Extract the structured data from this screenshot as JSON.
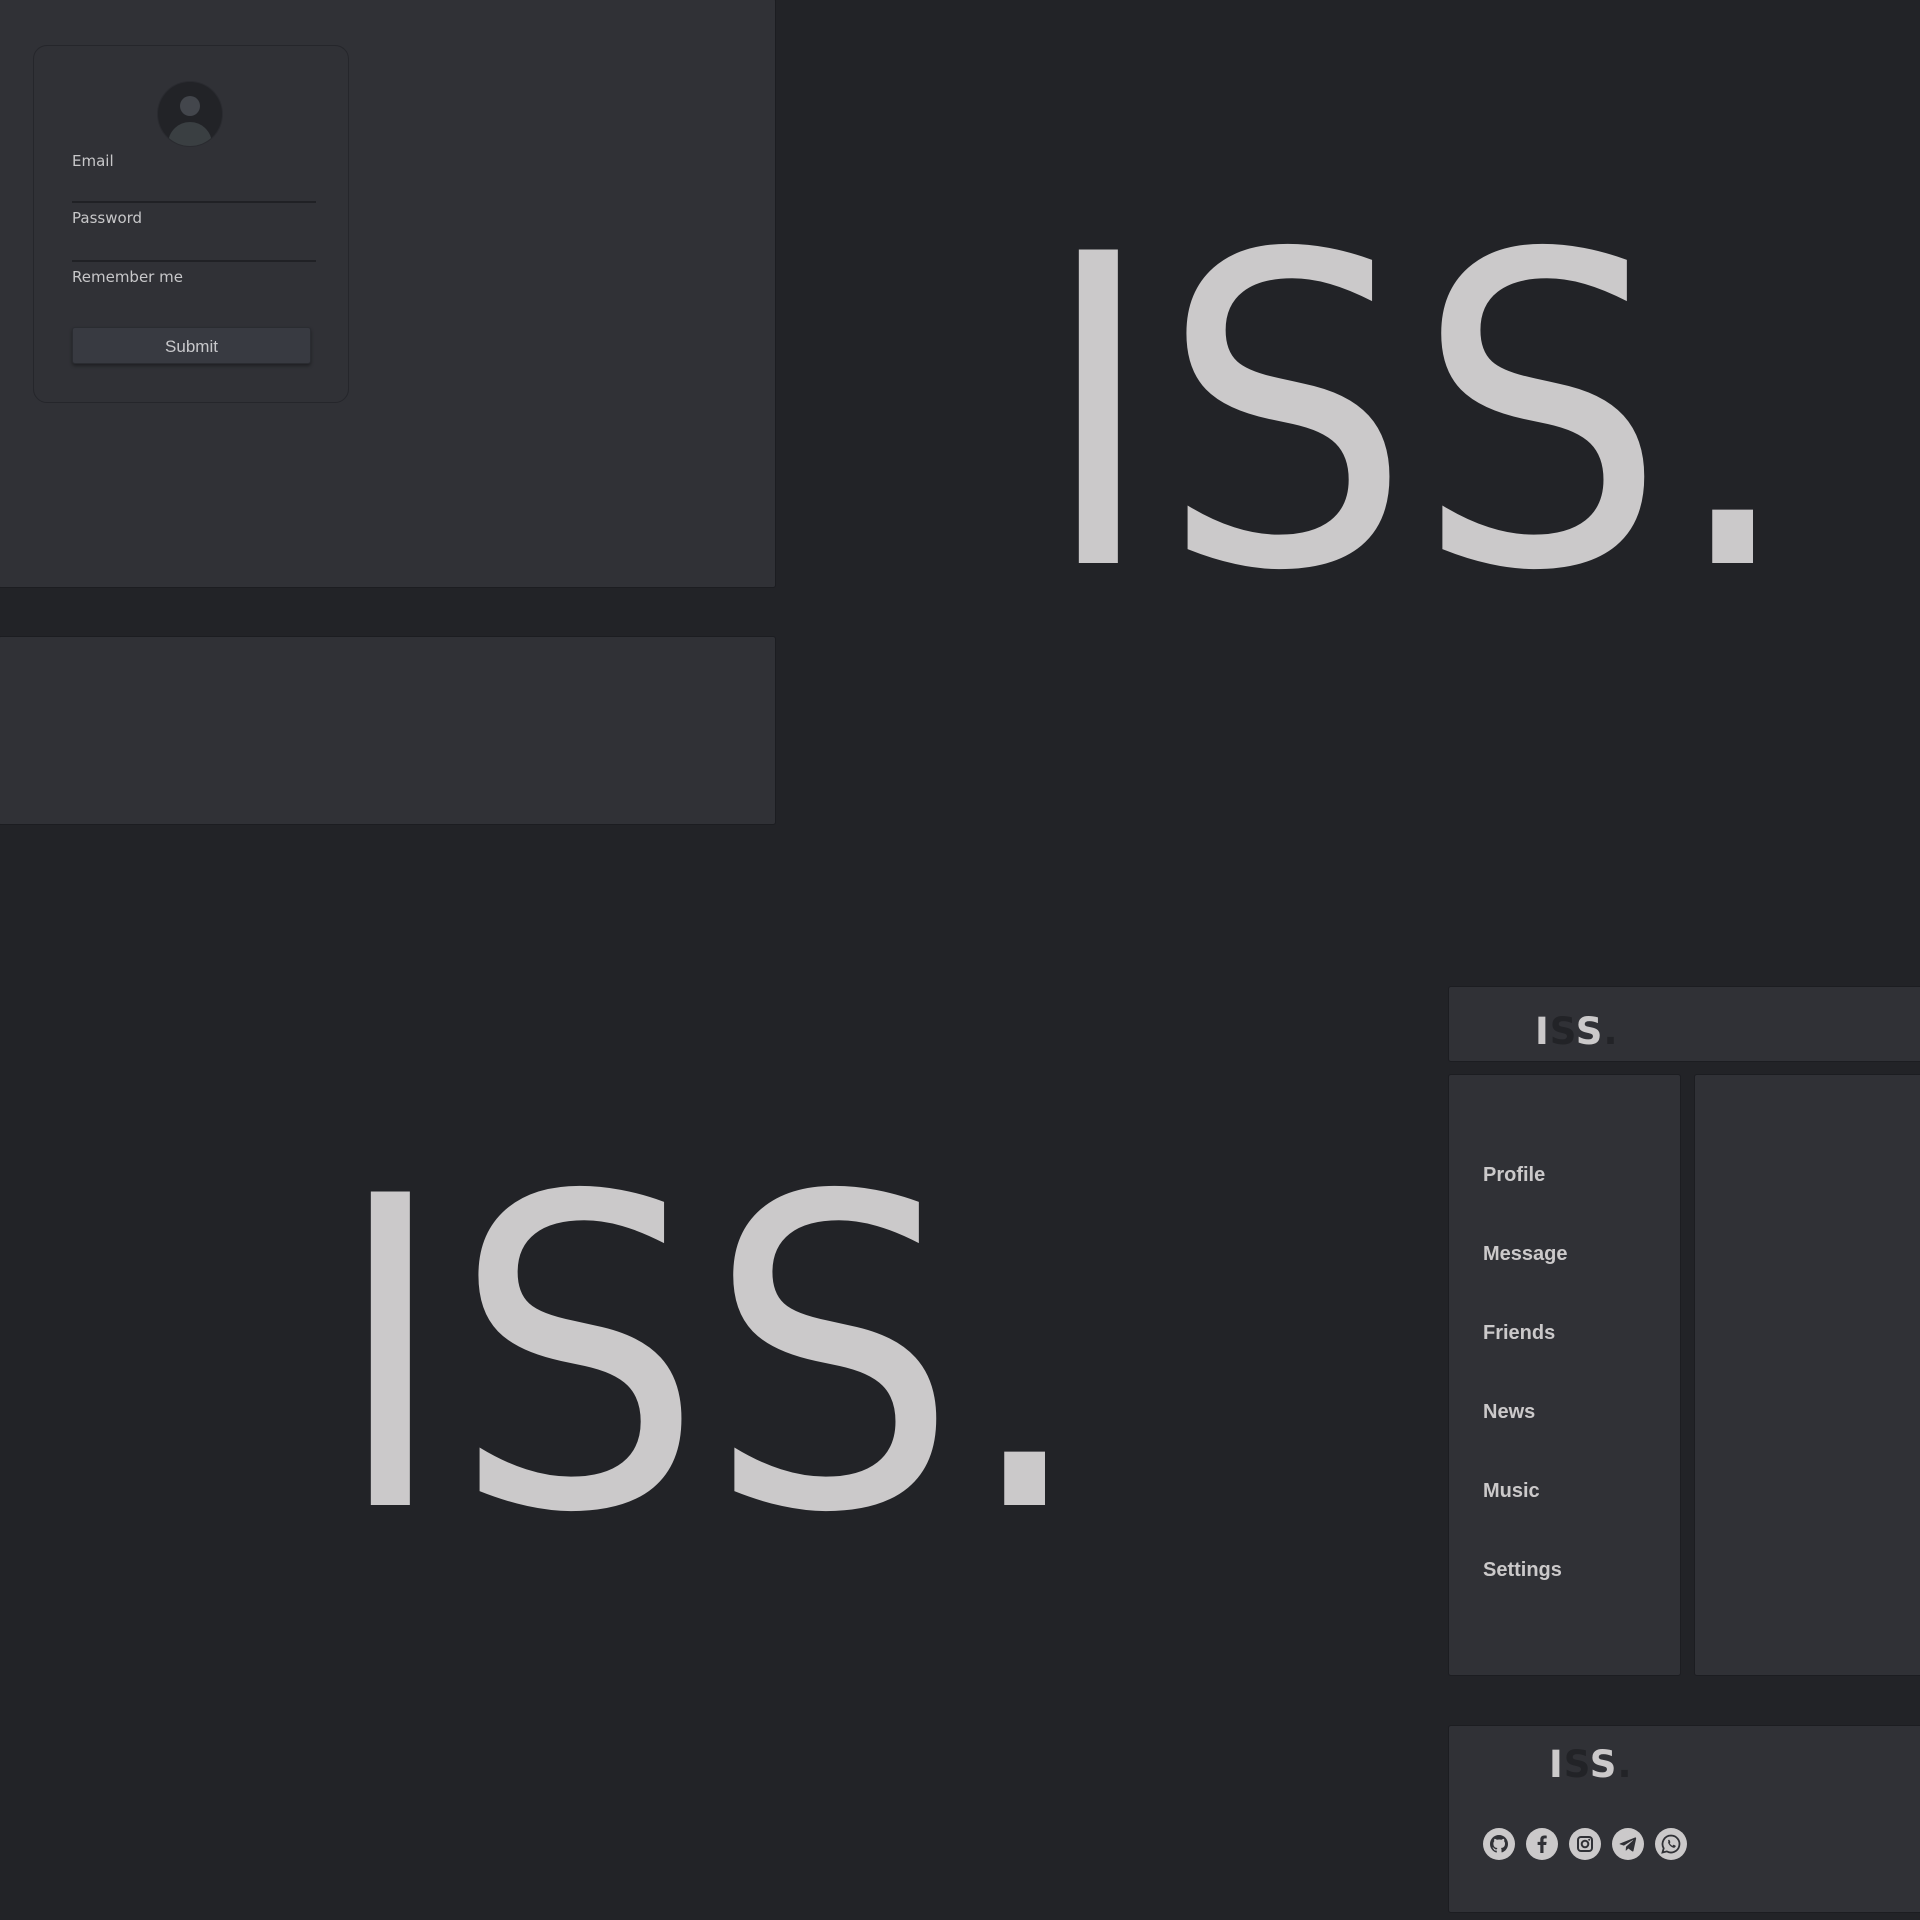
{
  "login": {
    "email_label": "Email",
    "password_label": "Password",
    "remember_label": "Remember me",
    "submit_label": "Submit"
  },
  "brand": {
    "logo_text": "ISS.",
    "logo_parts": [
      "I",
      "S",
      "S",
      "."
    ]
  },
  "sidebar": {
    "items": [
      {
        "label": "Profile"
      },
      {
        "label": "Message"
      },
      {
        "label": "Friends"
      },
      {
        "label": "News"
      },
      {
        "label": "Music"
      },
      {
        "label": "Settings"
      }
    ]
  },
  "footer": {
    "social_icons": [
      "github-icon",
      "facebook-icon",
      "instagram-icon",
      "telegram-icon",
      "whatsapp-icon"
    ]
  },
  "colors": {
    "background": "#222327",
    "panel": "#303136",
    "text": "#cbc9ca"
  }
}
